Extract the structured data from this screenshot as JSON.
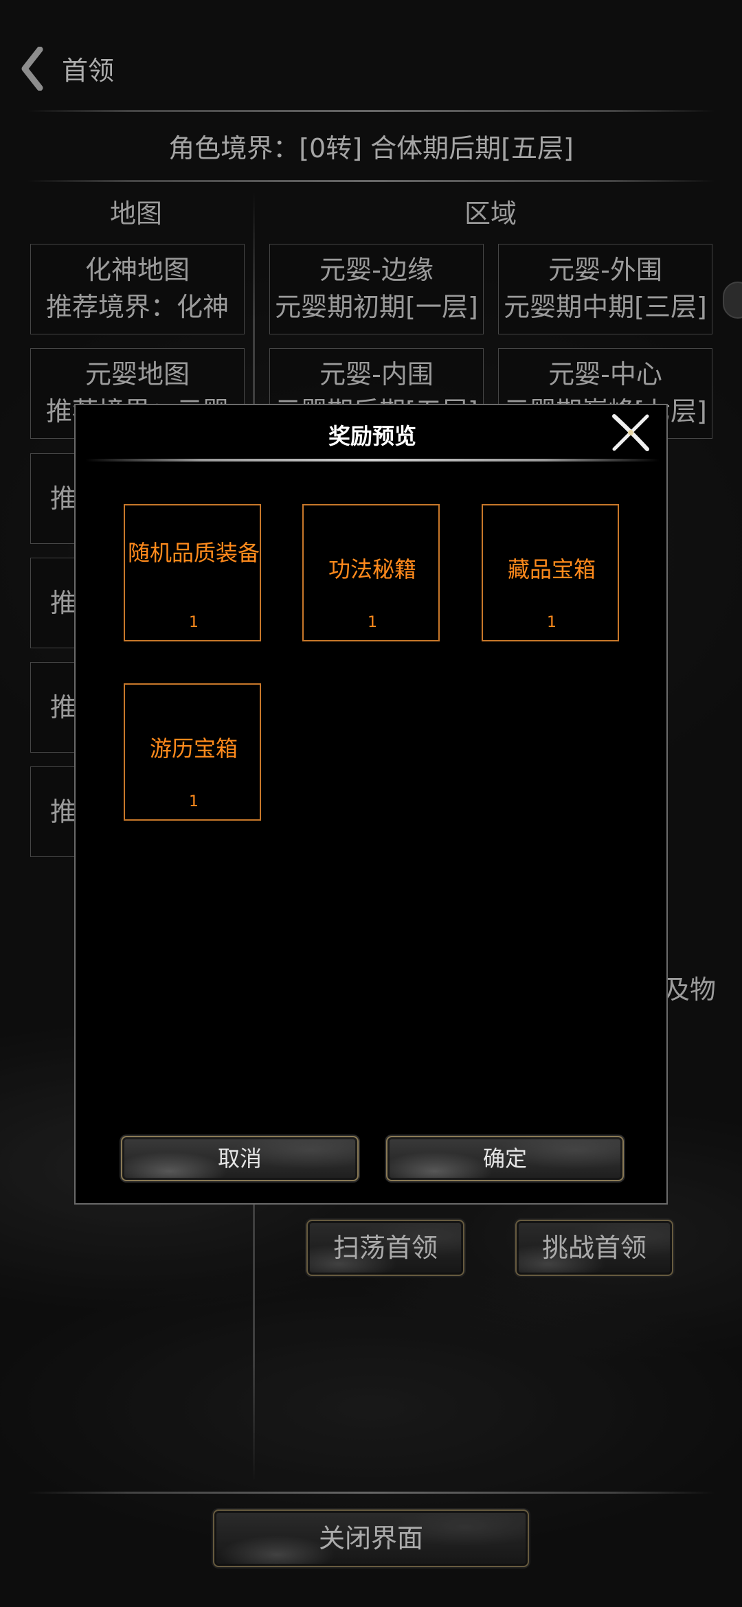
{
  "header": {
    "title": "首领"
  },
  "realm": "角色境界：[0转] 合体期后期[五层]",
  "columns": {
    "map": "地图",
    "region": "区域"
  },
  "map_cards": [
    {
      "name": "化神地图",
      "recommend": "推荐境界：化神"
    },
    {
      "name": "元婴地图",
      "recommend": "推荐境界：元婴"
    }
  ],
  "map_partial": [
    "推荐",
    "推荐",
    "推荐",
    "推荐"
  ],
  "region_cards": [
    {
      "name": "元婴-边缘",
      "level": "元婴期初期[一层]"
    },
    {
      "name": "元婴-外围",
      "level": "元婴期中期[三层]"
    },
    {
      "name": "元婴-内围",
      "level": "元婴期后期[五层]"
    },
    {
      "name": "元婴-中心",
      "level": "元婴期巅峰[七层]"
    }
  ],
  "partial_right_text": "及物",
  "actions": {
    "sweep": "扫荡首领",
    "challenge": "挑战首领",
    "close": "关闭界面"
  },
  "modal": {
    "title": "奖励预览",
    "rewards": [
      {
        "name": "随机品质装备",
        "count": "1"
      },
      {
        "name": "功法秘籍",
        "count": "1"
      },
      {
        "name": "藏品宝箱",
        "count": "1"
      },
      {
        "name": "游历宝箱",
        "count": "1"
      }
    ],
    "cancel": "取消",
    "confirm": "确定"
  },
  "colors": {
    "reward_border": "#c8782a",
    "reward_text": "#ff8a1c",
    "modal_bg": "#000000"
  }
}
